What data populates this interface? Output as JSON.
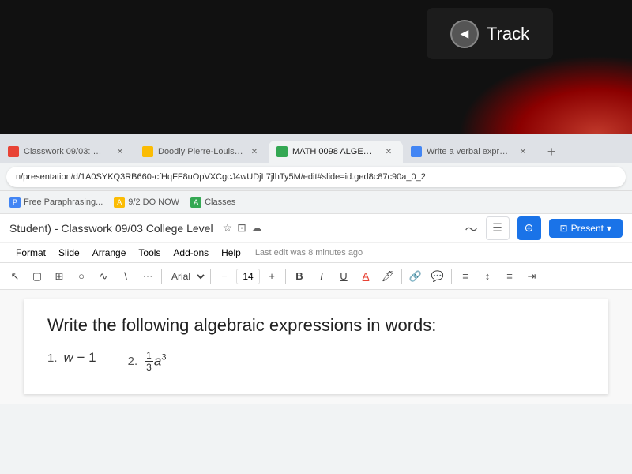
{
  "top": {
    "track_label": "Track",
    "track_icon": "◀"
  },
  "browser": {
    "tabs": [
      {
        "id": "tab1",
        "title": "Classwork 09/03: Writing Exp...",
        "favicon_color": "#e84335",
        "active": false
      },
      {
        "id": "tab2",
        "title": "Doodly Pierre-Louis (Student)",
        "favicon_color": "#fbbc04",
        "active": false
      },
      {
        "id": "tab3",
        "title": "MATH 0098 ALGEBRAIC EXPR...",
        "favicon_color": "#34a853",
        "active": true
      },
      {
        "id": "tab4",
        "title": "Write a verbal expression for...",
        "favicon_color": "#4285f4",
        "active": false
      }
    ],
    "address_bar": {
      "url": "n/presentation/d/1A0SYKQ3RB660-cfHqFF8uOpVXCgcJ4wUDjL7jlhTy5M/edit#slide=id.ged8c87c90a_0_2"
    },
    "bookmarks": [
      {
        "label": "Free Paraphrasing...",
        "icon_color": "#4285f4"
      },
      {
        "label": "9/2 DO NOW",
        "icon_color": "#fbbc04"
      },
      {
        "label": "Classes",
        "icon_color": "#34a853"
      }
    ]
  },
  "slides": {
    "title": "Student) - Classwork 09/03 College Level",
    "last_edit": "Last edit was 8 minutes ago",
    "menu_items": [
      "Format",
      "Slide",
      "Arrange",
      "Tools",
      "Add-ons",
      "Help"
    ],
    "toolbar": {
      "font": "Arial",
      "font_size": "14",
      "bold": "B",
      "italic": "I",
      "underline": "U"
    },
    "present_label": "Present"
  },
  "slide": {
    "heading": "Write the following algebraic expressions in words:",
    "items": [
      {
        "number": "1.",
        "expression": "w − 1"
      },
      {
        "number": "2.",
        "expression_parts": {
          "coefficient": "1",
          "denominator": "3",
          "variable": "a",
          "exponent": "3"
        }
      }
    ]
  }
}
